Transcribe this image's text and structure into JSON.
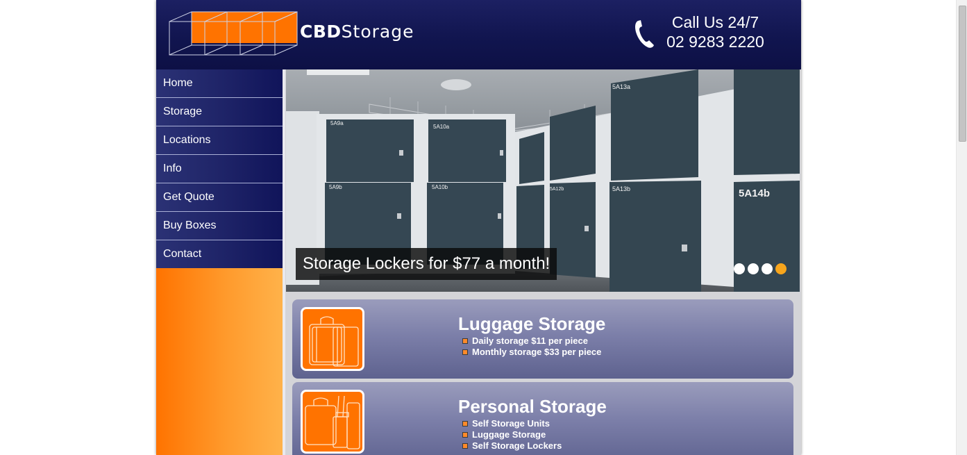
{
  "brand": {
    "name_bold": "CBD",
    "name_regular": "Storage",
    "accent_color": "#ff7300",
    "header_color": "#11154f"
  },
  "header": {
    "call_line1": "Call Us 24/7",
    "call_line2": "02 9283 2220",
    "phone_icon": "phone-icon"
  },
  "nav": {
    "items": [
      {
        "label": "Home"
      },
      {
        "label": "Storage"
      },
      {
        "label": "Locations"
      },
      {
        "label": "Info"
      },
      {
        "label": "Get Quote"
      },
      {
        "label": "Buy Boxes"
      },
      {
        "label": "Contact"
      }
    ]
  },
  "slider": {
    "caption": "Storage Lockers for $77 a month!",
    "slide_count": 4,
    "active_slide": 4,
    "locker_labels": [
      "5A9a",
      "5A10a",
      "5A13a",
      "5A9b",
      "5A10b",
      "5A12b",
      "5A13b",
      "5A14b"
    ]
  },
  "cards": [
    {
      "title": "Luggage Storage",
      "icon": "luggage-icon",
      "items": [
        "Daily storage $11 per piece",
        "Monthly storage $33 per piece"
      ]
    },
    {
      "title": "Personal Storage",
      "icon": "personal-storage-icon",
      "items": [
        "Self Storage Units",
        "Luggage Storage",
        "Self Storage Lockers"
      ]
    }
  ]
}
